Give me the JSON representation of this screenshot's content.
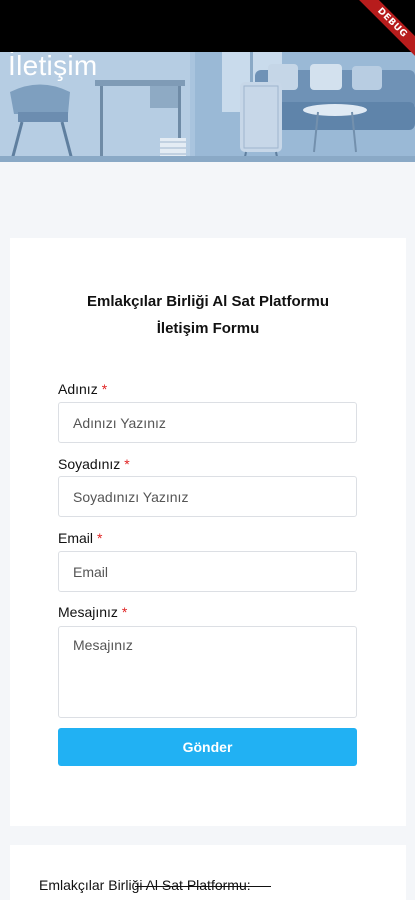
{
  "page": {
    "title": "İletişim",
    "debug_badge": "DEBUG"
  },
  "form": {
    "title_line1": "Emlakçılar Birliği Al Sat Platformu",
    "title_line2": "İletişim Formu",
    "required_mark": "*",
    "fields": {
      "name": {
        "label": "Adınız",
        "placeholder": "Adınızı Yazınız"
      },
      "surname": {
        "label": "Soyadınız",
        "placeholder": "Soyadınızı Yazınız"
      },
      "email": {
        "label": "Email",
        "placeholder": "Email"
      },
      "message": {
        "label": "Mesajınız",
        "placeholder": "Mesajınız"
      }
    },
    "submit_label": "Gönder"
  },
  "info": {
    "title": "Emlakçılar Birliği Al Sat Platformu:"
  },
  "colors": {
    "accent": "#21b1f3",
    "required": "#e02424",
    "hero_tint": "#8fb6d8"
  }
}
